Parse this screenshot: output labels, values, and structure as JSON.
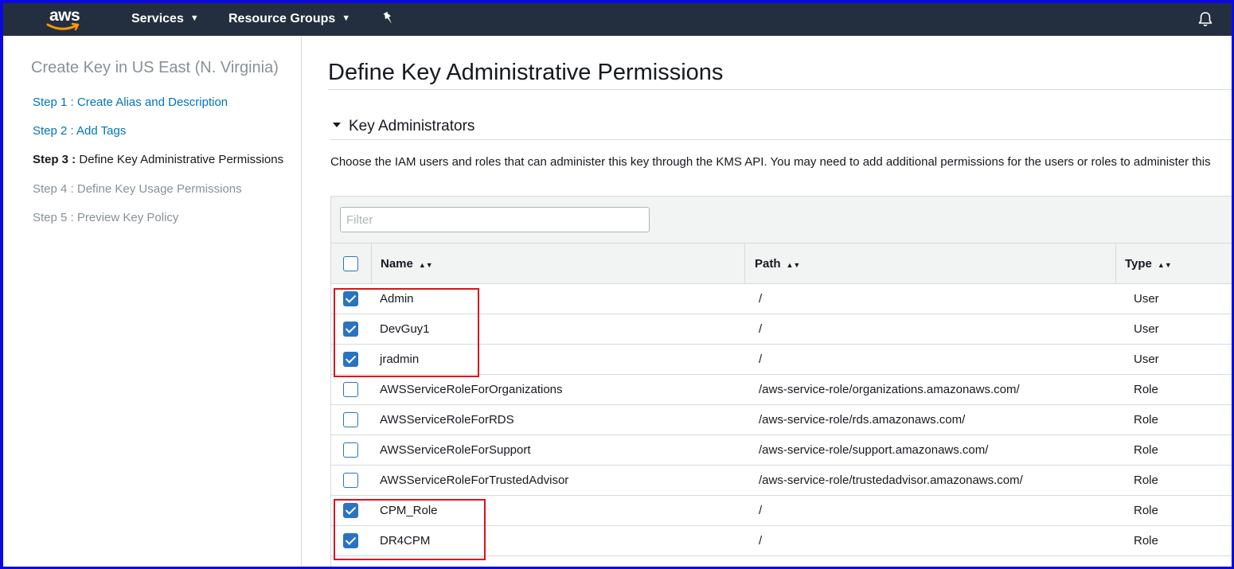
{
  "topnav": {
    "logo_text": "aws",
    "services_label": "Services",
    "resource_groups_label": "Resource Groups",
    "chevron_glyph": "▼",
    "icons": [
      "aws-logo",
      "pin-icon",
      "bell-icon"
    ],
    "background": "#232f3e"
  },
  "sidebar": {
    "title": "Create Key in US East (N. Virginia)",
    "steps": [
      {
        "prefix": "Step 1",
        "label": " : Create Alias and Description",
        "state": "link"
      },
      {
        "prefix": "Step 2",
        "label": " : Add Tags",
        "state": "link"
      },
      {
        "prefix": "Step 3",
        "label": " : Define Key Administrative Permissions",
        "state": "current"
      },
      {
        "prefix": "Step 4",
        "label": " : Define Key Usage Permissions",
        "state": "disabled"
      },
      {
        "prefix": "Step 5",
        "label": " : Preview Key Policy",
        "state": "disabled"
      }
    ]
  },
  "main": {
    "title": "Define Key Administrative Permissions",
    "section_title": "Key Administrators",
    "description": "Choose the IAM users and roles that can administer this key through the KMS API. You may need to add additional permissions for the users or roles to administer this",
    "filter_placeholder": "Filter",
    "columns": {
      "name": "Name",
      "path": "Path",
      "type": "Type"
    },
    "sort_glyph": "▲▼",
    "rows": [
      {
        "name": "Admin",
        "path": "/",
        "type": "User",
        "checked": true
      },
      {
        "name": "DevGuy1",
        "path": "/",
        "type": "User",
        "checked": true
      },
      {
        "name": "jradmin",
        "path": "/",
        "type": "User",
        "checked": true
      },
      {
        "name": "AWSServiceRoleForOrganizations",
        "path": "/aws-service-role/organizations.amazonaws.com/",
        "type": "Role",
        "checked": false
      },
      {
        "name": "AWSServiceRoleForRDS",
        "path": "/aws-service-role/rds.amazonaws.com/",
        "type": "Role",
        "checked": false
      },
      {
        "name": "AWSServiceRoleForSupport",
        "path": "/aws-service-role/support.amazonaws.com/",
        "type": "Role",
        "checked": false
      },
      {
        "name": "AWSServiceRoleForTrustedAdvisor",
        "path": "/aws-service-role/trustedadvisor.amazonaws.com/",
        "type": "Role",
        "checked": false
      },
      {
        "name": "CPM_Role",
        "path": "/",
        "type": "Role",
        "checked": true
      },
      {
        "name": "DR4CPM",
        "path": "/",
        "type": "Role",
        "checked": true
      }
    ]
  },
  "colors": {
    "link": "#0073bb",
    "checkbox": "#2a73c2",
    "highlight": "#e0111a",
    "frame": "#0a0ae0"
  }
}
